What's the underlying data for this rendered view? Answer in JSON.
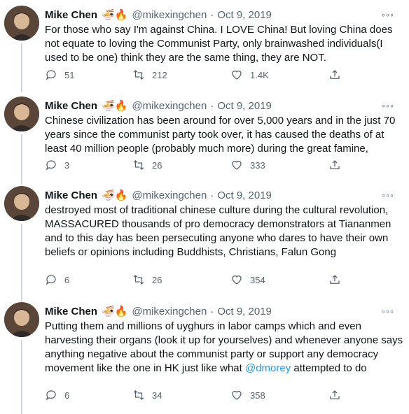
{
  "tweets": [
    {
      "name": "Mike Chen",
      "emoji": "🍜🔥",
      "handle": "@mikexingchen",
      "dot": "·",
      "time": "Oct 9, 2019",
      "more": "◦◦◦",
      "text": "For those who say I'm against China. I LOVE China! But loving China does not equate to loving the Communist Party, only brainwashed individuals(I used to be one) think they are the same thing, they are NOT.",
      "replies": "51",
      "retweets": "212",
      "likes": "1.4K"
    },
    {
      "name": "Mike Chen",
      "emoji": "🍜🔥",
      "handle": "@mikexingchen",
      "dot": "·",
      "time": "Oct 9, 2019",
      "more": "◦◦◦",
      "text": "Chinese civilization has been around for over 5,000 years and in the just 70 years since the communist party took over, it has caused the deaths of at least 40 million people (probably much more) during the great famine,",
      "replies": "3",
      "retweets": "26",
      "likes": "333"
    },
    {
      "name": "Mike Chen",
      "emoji": "🍜🔥",
      "handle": "@mikexingchen",
      "dot": "·",
      "time": "Oct 9, 2019",
      "more": "◦◦◦",
      "text": "destroyed most of traditional chinese culture during the cultural revolution, MASSACURED thousands of pro democracy demonstrators at Tiananmen and to this day has been persecuting anyone who dares to have their own beliefs or opinions including Buddhists, Christians, Falun Gong",
      "replies": "6",
      "retweets": "26",
      "likes": "354"
    },
    {
      "name": "Mike Chen",
      "emoji": "🍜🔥",
      "handle": "@mikexingchen",
      "dot": "·",
      "time": "Oct 9, 2019",
      "more": "◦◦◦",
      "text_before_mention": "Putting them and millions of uyghurs in labor camps which and even harvesting their organs (look it up for yourselves) and whenever anyone says anything negative about the communist party or support any democracy movement like the one in HK just like what ",
      "mention": "@dmorey",
      "text_after_mention": " attempted to do",
      "replies": "6",
      "retweets": "34",
      "likes": "358"
    }
  ],
  "colors": {
    "text": "#0f1419",
    "secondary": "#536471",
    "link": "#1d9bf0",
    "thread_line": "#cfd9de"
  }
}
